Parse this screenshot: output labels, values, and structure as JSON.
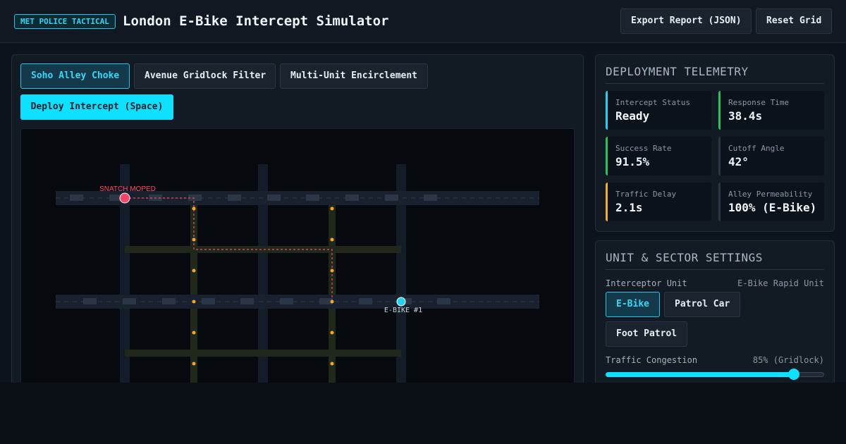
{
  "header": {
    "badge": "MET POLICE TACTICAL",
    "title": "London E-Bike Intercept Simulator",
    "export_label": "Export Report (JSON)",
    "reset_label": "Reset Grid"
  },
  "scenarios": {
    "tabs": [
      {
        "label": "Soho Alley Choke",
        "active": true
      },
      {
        "label": "Avenue Gridlock Filter",
        "active": false
      },
      {
        "label": "Multi-Unit Encirclement",
        "active": false
      }
    ],
    "deploy_label": "Deploy Intercept (Space)"
  },
  "map": {
    "suspect_label": "SNATCH MOPED",
    "unit_label": "E-BIKE #1",
    "colors": {
      "suspect": "#ff4466",
      "unit": "#1ed4f0",
      "waypoint": "#f5a623",
      "path": "#c44a5a",
      "road": "#1a2330",
      "alley": "#232a1e"
    }
  },
  "telemetry": {
    "title": "DEPLOYMENT TELEMETRY",
    "metrics": [
      {
        "label": "Intercept Status",
        "value": "Ready",
        "accent": "#1ed4f0"
      },
      {
        "label": "Response Time",
        "value": "38.4s",
        "accent": "#22c55e"
      },
      {
        "label": "Success Rate",
        "value": "91.5%",
        "accent": "#22c55e"
      },
      {
        "label": "Cutoff Angle",
        "value": "42°",
        "accent": "#2a3644"
      },
      {
        "label": "Traffic Delay",
        "value": "2.1s",
        "accent": "#f5b02a"
      },
      {
        "label": "Alley Permeability",
        "value": "100% (E-Bike)",
        "accent": "#2a3644"
      }
    ]
  },
  "settings": {
    "title": "UNIT & SECTOR SETTINGS",
    "unit_label": "Interceptor Unit",
    "unit_value": "E-Bike Rapid Unit",
    "units": [
      {
        "label": "E-Bike",
        "active": true
      },
      {
        "label": "Patrol Car",
        "active": false
      },
      {
        "label": "Foot Patrol",
        "active": false
      }
    ],
    "congestion_label": "Traffic Congestion",
    "congestion_value": "85% (Gridlock)",
    "congestion_level": 0.86
  }
}
